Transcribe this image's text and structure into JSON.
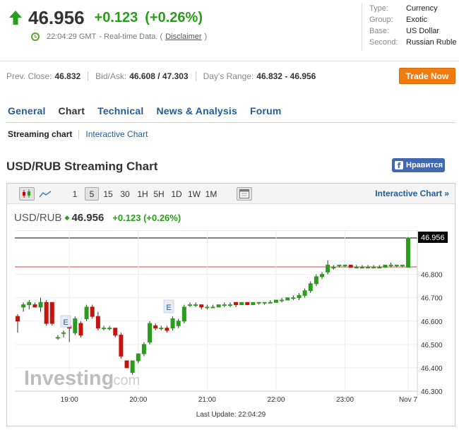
{
  "quote": {
    "price": "46.956",
    "change": "+0.123",
    "change_pct": "(+0.26%)",
    "time": "22:04:29 GMT",
    "time_note": "- Real-time Data. (",
    "disclaimer": "Disclaimer",
    "close_paren": ")",
    "up_color": "#2a9d1c"
  },
  "info": [
    {
      "k": "Type:",
      "v": "Currency"
    },
    {
      "k": "Group:",
      "v": "Exotic"
    },
    {
      "k": "Base:",
      "v": "US Dollar"
    },
    {
      "k": "Second:",
      "v": "Russian Ruble"
    }
  ],
  "stats": {
    "prev_close_label": "Prev. Close:",
    "prev_close": "46.832",
    "bidask_label": "Bid/Ask:",
    "bid": "46.608",
    "slash": " / ",
    "ask": "47.303",
    "range_label": "Day's Range:",
    "range": "46.832 - 46.956"
  },
  "trade_now": "Trade Now",
  "tabs": [
    "General",
    "Chart",
    "Technical",
    "News & Analysis",
    "Forum"
  ],
  "subtabs": {
    "active": "Streaming chart",
    "link": "Interactive Chart"
  },
  "chart_title": "USD/RUB Streaming Chart",
  "fb_like": "Нравится",
  "fb_f": "f",
  "toolbar": {
    "intervals": [
      "1",
      "5",
      "15",
      "30",
      "1H",
      "5H",
      "1D",
      "1W",
      "1M"
    ],
    "selected": "5",
    "interactive_link": "Interactive Chart »",
    "icons": [
      "candlestick-icon",
      "line-chart-icon",
      "calendar-icon"
    ]
  },
  "legend": {
    "symbol": "USD/RUB",
    "price": "46.956",
    "change": "+0.123 (+0.26%)"
  },
  "watermark": {
    "main": "Investing",
    "suffix": ".com"
  },
  "last_update": "Last Update: 22:04:29",
  "event_marker": "E",
  "price_tag": "46.956",
  "chart_data": {
    "type": "candlestick",
    "symbol": "USD/RUB",
    "interval": "5m",
    "y_ticks": [
      "46.800",
      "46.700",
      "46.600",
      "46.500",
      "46.400",
      "46.300"
    ],
    "x_ticks": [
      "19:00",
      "20:00",
      "21:00",
      "22:00",
      "23:00",
      "Nov 7"
    ],
    "ylim": [
      46.3,
      46.956
    ],
    "prev_close": 46.832,
    "last": 46.956,
    "candles": [
      {
        "o": 46.62,
        "h": 46.63,
        "l": 46.55,
        "c": 46.6
      },
      {
        "o": 46.66,
        "h": 46.68,
        "l": 46.64,
        "c": 46.67
      },
      {
        "o": 46.67,
        "h": 46.69,
        "l": 46.65,
        "c": 46.68
      },
      {
        "o": 46.67,
        "h": 46.68,
        "l": 46.66,
        "c": 46.66
      },
      {
        "o": 46.66,
        "h": 46.7,
        "l": 46.64,
        "c": 46.68
      },
      {
        "o": 46.68,
        "h": 46.69,
        "l": 46.58,
        "c": 46.59
      },
      {
        "o": 46.68,
        "h": 46.68,
        "l": 46.58,
        "c": 46.59
      },
      {
        "o": 46.53,
        "h": 46.54,
        "l": 46.52,
        "c": 46.53
      },
      {
        "o": 46.55,
        "h": 46.56,
        "l": 46.53,
        "c": 46.55
      },
      {
        "o": 46.58,
        "h": 46.6,
        "l": 46.51,
        "c": 46.57
      },
      {
        "o": 46.55,
        "h": 46.62,
        "l": 46.54,
        "c": 46.61
      },
      {
        "o": 46.59,
        "h": 46.6,
        "l": 46.53,
        "c": 46.54
      },
      {
        "o": 46.61,
        "h": 46.67,
        "l": 46.6,
        "c": 46.66
      },
      {
        "o": 46.66,
        "h": 46.67,
        "l": 46.61,
        "c": 46.62
      },
      {
        "o": 46.62,
        "h": 46.64,
        "l": 46.56,
        "c": 46.57
      },
      {
        "o": 46.57,
        "h": 46.58,
        "l": 46.56,
        "c": 46.57
      },
      {
        "o": 46.57,
        "h": 46.58,
        "l": 46.56,
        "c": 46.57
      },
      {
        "o": 46.57,
        "h": 46.57,
        "l": 46.53,
        "c": 46.54
      },
      {
        "o": 46.54,
        "h": 46.55,
        "l": 46.44,
        "c": 46.45
      },
      {
        "o": 46.43,
        "h": 46.43,
        "l": 46.4,
        "c": 46.4
      },
      {
        "o": 46.38,
        "h": 46.43,
        "l": 46.37,
        "c": 46.43
      },
      {
        "o": 46.43,
        "h": 46.46,
        "l": 46.42,
        "c": 46.46
      },
      {
        "o": 46.46,
        "h": 46.51,
        "l": 46.45,
        "c": 46.5
      },
      {
        "o": 46.51,
        "h": 46.6,
        "l": 46.5,
        "c": 46.59
      },
      {
        "o": 46.58,
        "h": 46.59,
        "l": 46.56,
        "c": 46.57
      },
      {
        "o": 46.57,
        "h": 46.58,
        "l": 46.56,
        "c": 46.57
      },
      {
        "o": 46.57,
        "h": 46.58,
        "l": 46.55,
        "c": 46.56
      },
      {
        "o": 46.57,
        "h": 46.62,
        "l": 46.56,
        "c": 46.61
      },
      {
        "o": 46.58,
        "h": 46.61,
        "l": 46.57,
        "c": 46.6
      },
      {
        "o": 46.6,
        "h": 46.67,
        "l": 46.59,
        "c": 46.66
      },
      {
        "o": 46.67,
        "h": 46.68,
        "l": 46.66,
        "c": 46.67
      },
      {
        "o": 46.67,
        "h": 46.68,
        "l": 46.66,
        "c": 46.67
      },
      {
        "o": 46.67,
        "h": 46.67,
        "l": 46.65,
        "c": 46.66
      },
      {
        "o": 46.66,
        "h": 46.67,
        "l": 46.65,
        "c": 46.66
      },
      {
        "o": 46.66,
        "h": 46.67,
        "l": 46.66,
        "c": 46.66
      },
      {
        "o": 46.66,
        "h": 46.67,
        "l": 46.66,
        "c": 46.67
      },
      {
        "o": 46.67,
        "h": 46.68,
        "l": 46.66,
        "c": 46.67
      },
      {
        "o": 46.67,
        "h": 46.68,
        "l": 46.66,
        "c": 46.67
      },
      {
        "o": 46.68,
        "h": 46.68,
        "l": 46.66,
        "c": 46.67
      },
      {
        "o": 46.67,
        "h": 46.68,
        "l": 46.67,
        "c": 46.68
      },
      {
        "o": 46.68,
        "h": 46.68,
        "l": 46.67,
        "c": 46.67
      },
      {
        "o": 46.67,
        "h": 46.68,
        "l": 46.67,
        "c": 46.68
      },
      {
        "o": 46.68,
        "h": 46.68,
        "l": 46.67,
        "c": 46.68
      },
      {
        "o": 46.68,
        "h": 46.68,
        "l": 46.67,
        "c": 46.68
      },
      {
        "o": 46.68,
        "h": 46.69,
        "l": 46.68,
        "c": 46.68
      },
      {
        "o": 46.68,
        "h": 46.69,
        "l": 46.68,
        "c": 46.69
      },
      {
        "o": 46.69,
        "h": 46.7,
        "l": 46.68,
        "c": 46.69
      },
      {
        "o": 46.69,
        "h": 46.7,
        "l": 46.69,
        "c": 46.7
      },
      {
        "o": 46.7,
        "h": 46.71,
        "l": 46.69,
        "c": 46.7
      },
      {
        "o": 46.7,
        "h": 46.72,
        "l": 46.69,
        "c": 46.71
      },
      {
        "o": 46.71,
        "h": 46.74,
        "l": 46.7,
        "c": 46.73
      },
      {
        "o": 46.73,
        "h": 46.77,
        "l": 46.72,
        "c": 46.76
      },
      {
        "o": 46.76,
        "h": 46.8,
        "l": 46.75,
        "c": 46.79
      },
      {
        "o": 46.79,
        "h": 46.81,
        "l": 46.78,
        "c": 46.8
      },
      {
        "o": 46.81,
        "h": 46.86,
        "l": 46.8,
        "c": 46.84
      },
      {
        "o": 46.83,
        "h": 46.84,
        "l": 46.82,
        "c": 46.83
      },
      {
        "o": 46.84,
        "h": 46.84,
        "l": 46.83,
        "c": 46.84
      },
      {
        "o": 46.84,
        "h": 46.84,
        "l": 46.83,
        "c": 46.84
      },
      {
        "o": 46.84,
        "h": 46.84,
        "l": 46.83,
        "c": 46.83
      },
      {
        "o": 46.83,
        "h": 46.84,
        "l": 46.83,
        "c": 46.83
      },
      {
        "o": 46.83,
        "h": 46.84,
        "l": 46.83,
        "c": 46.83
      },
      {
        "o": 46.83,
        "h": 46.84,
        "l": 46.83,
        "c": 46.83
      },
      {
        "o": 46.83,
        "h": 46.84,
        "l": 46.83,
        "c": 46.83
      },
      {
        "o": 46.83,
        "h": 46.84,
        "l": 46.83,
        "c": 46.83
      },
      {
        "o": 46.83,
        "h": 46.84,
        "l": 46.83,
        "c": 46.84
      },
      {
        "o": 46.84,
        "h": 46.85,
        "l": 46.83,
        "c": 46.84
      },
      {
        "o": 46.84,
        "h": 46.84,
        "l": 46.83,
        "c": 46.84
      },
      {
        "o": 46.84,
        "h": 46.84,
        "l": 46.83,
        "c": 46.84
      },
      {
        "o": 46.83,
        "h": 46.96,
        "l": 46.83,
        "c": 46.956
      }
    ]
  }
}
